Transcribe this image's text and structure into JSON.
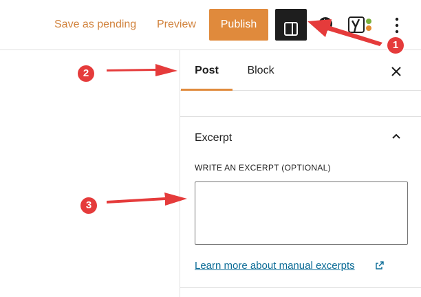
{
  "header": {
    "save_pending_label": "Save as pending",
    "preview_label": "Preview",
    "publish_label": "Publish",
    "settings_icon": "sidebar-toggle-icon",
    "jetpack_icon": "jetpack-icon",
    "yoast_icon": "yoast-icon",
    "more_icon": "more-vertical-icon"
  },
  "sidebar": {
    "tabs": [
      {
        "label": "Post",
        "active": true
      },
      {
        "label": "Block",
        "active": false
      }
    ],
    "close_icon": "close-icon"
  },
  "excerpt": {
    "title": "Excerpt",
    "label": "WRITE AN EXCERPT (OPTIONAL)",
    "value": "",
    "link_text": "Learn more about manual excerpts",
    "chevron_icon": "chevron-up-icon",
    "external_icon": "external-link-icon"
  },
  "callouts": [
    "1",
    "2",
    "3"
  ],
  "colors": {
    "accent": "#e08a3c",
    "link": "#0a6b96",
    "callout": "#e53b3b",
    "dark_button": "#1e1e1e"
  }
}
